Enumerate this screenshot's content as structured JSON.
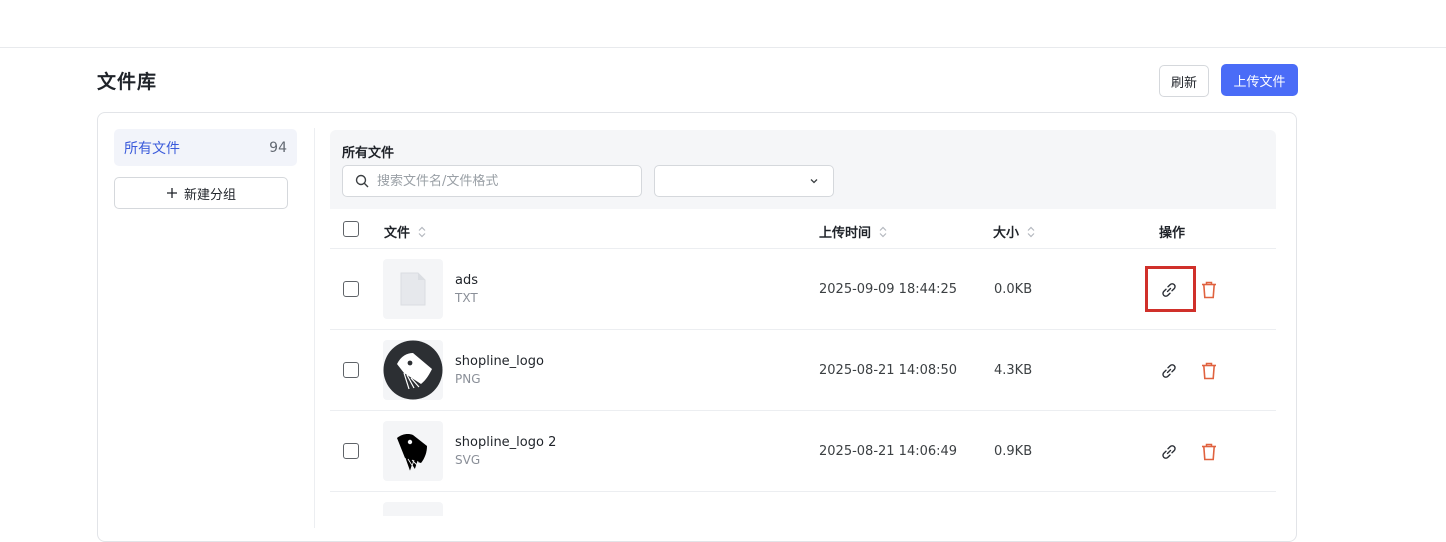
{
  "page": {
    "title": "文件库",
    "refresh_label": "刷新",
    "upload_label": "上传文件"
  },
  "sidebar": {
    "groups": [
      {
        "label": "所有文件",
        "count": "94"
      }
    ],
    "new_group_label": "新建分组"
  },
  "filter": {
    "title": "所有文件",
    "search_placeholder": "搜索文件名/文件格式",
    "type_select_value": ""
  },
  "table": {
    "columns": [
      "文件",
      "上传时间",
      "大小",
      "操作"
    ],
    "rows": [
      {
        "name": "ads",
        "type": "TXT",
        "uploaded": "2025-09-09 18:44:25",
        "size": "0.0KB",
        "thumb": "file-icon"
      },
      {
        "name": "shopline_logo",
        "type": "PNG",
        "uploaded": "2025-08-21 14:08:50",
        "size": "4.3KB",
        "thumb": "shopline-logo-circle"
      },
      {
        "name": "shopline_logo 2",
        "type": "SVG",
        "uploaded": "2025-08-21 14:06:49",
        "size": "0.9KB",
        "thumb": "shopline-logo-tag"
      }
    ]
  },
  "colors": {
    "primary": "#4a6cf7",
    "delete": "#e0623f",
    "highlight": "#d0302a"
  }
}
